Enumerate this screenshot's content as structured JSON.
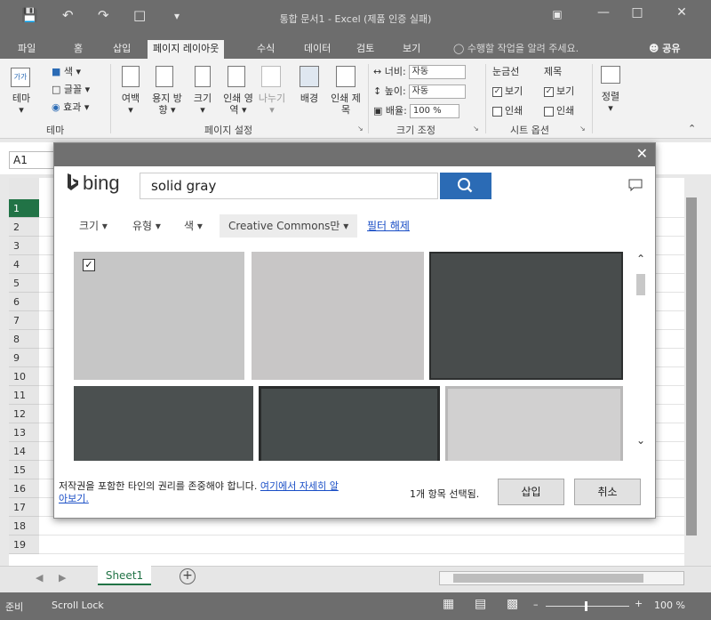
{
  "window": {
    "title": "통합 문서1 - Excel (제품 인증 실패)"
  },
  "ribbon_tabs": [
    "파일",
    "홈",
    "삽입",
    "페이지 레이아웃",
    "수식",
    "데이터",
    "검토",
    "보기"
  ],
  "tell_me": "수행할 작업을 알려 주세요.",
  "share": "공유",
  "ribbon": {
    "theme": {
      "label": "테마",
      "colors": "색",
      "fonts": "글꼴",
      "effects": "효과",
      "theme_icon_text": "가가"
    },
    "page_setup": {
      "margins": "여백",
      "orientation": "용지 방향",
      "size": "크기",
      "print_area": "인쇄 영역",
      "breaks": "나누기",
      "background": "배경",
      "print_titles": "인쇄 제목",
      "group_label": "페이지 설정"
    },
    "scale": {
      "width_label": "너비:",
      "width_value": "자동",
      "height_label": "높이:",
      "height_value": "자동",
      "scale_label": "배율:",
      "scale_value": "100 %",
      "group_label": "크기 조정"
    },
    "sheet_options": {
      "gridlines": "눈금선",
      "headings": "제목",
      "view": "보기",
      "print": "인쇄",
      "group_label": "시트 옵션"
    },
    "arrange": {
      "label": "정렬"
    },
    "theme_group_label": "테마"
  },
  "name_box": "A1",
  "rows": [
    "1",
    "2",
    "3",
    "4",
    "5",
    "6",
    "7",
    "8",
    "9",
    "10",
    "11",
    "12",
    "13",
    "14",
    "15",
    "16",
    "17",
    "18",
    "19"
  ],
  "sheet_tab": "Sheet1",
  "status": {
    "ready": "준비",
    "scroll_lock": "Scroll Lock",
    "zoom": "100 %"
  },
  "dialog": {
    "bing_label": "bing",
    "search_value": "solid gray",
    "filters": {
      "size": "크기",
      "type": "유형",
      "color": "색",
      "license": "Creative Commons만",
      "clear": "필터 해제"
    },
    "footer_notice": "저작권을 포함한 타인의 권리를 존중해야 합니다.",
    "footer_link": "여기에서 자세히 알아보기.",
    "selected_count": "1개 항목 선택됨.",
    "insert_label": "삽입",
    "cancel_label": "취소",
    "results": [
      {
        "color": "#c6c6c6",
        "selected": true
      },
      {
        "color": "#c8c6c6",
        "selected": false
      },
      {
        "color": "#484c4c",
        "selected": false
      },
      {
        "color": "#4b5050",
        "selected": false
      },
      {
        "color": "#474d4d",
        "selected": false
      },
      {
        "color": "#d1d0d0",
        "selected": false
      }
    ]
  },
  "colors": {
    "accent_green": "#217346",
    "search_blue": "#2b6bb5",
    "link_blue": "#1a4ec6",
    "chrome_gray": "#6d6d6d"
  }
}
